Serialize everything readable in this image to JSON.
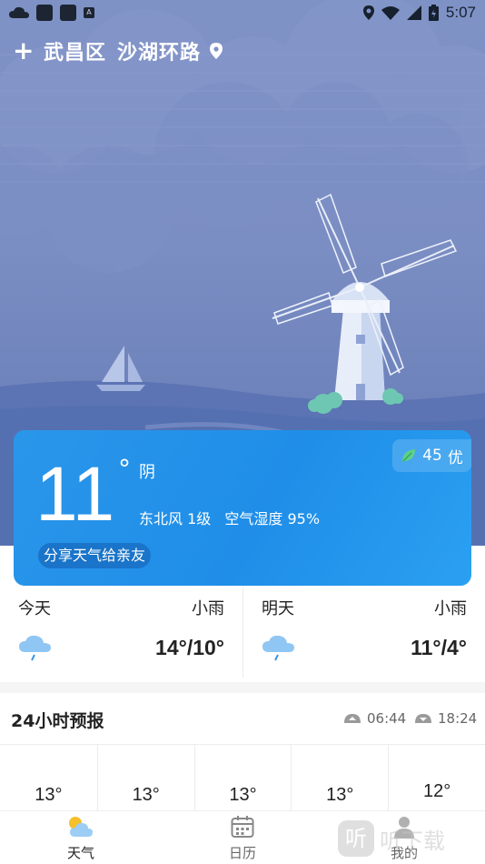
{
  "status_bar": {
    "time": "5:07",
    "a_icon_text": "A"
  },
  "location": {
    "add_label": "+",
    "district": "武昌区",
    "street": "沙湖环路"
  },
  "current": {
    "temperature": "11",
    "degree_symbol": "°",
    "condition": "阴",
    "wind": "东北风 1级",
    "humidity": "空气湿度 95%",
    "aqi_value": "45",
    "aqi_level": "优",
    "share_label": "分享天气给亲友"
  },
  "daily": [
    {
      "name": "今天",
      "condition": "小雨",
      "temp": "14°/10°",
      "icon": "light-rain-icon"
    },
    {
      "name": "明天",
      "condition": "小雨",
      "temp": "11°/4°",
      "icon": "light-rain-icon"
    }
  ],
  "forecast": {
    "title": "24小时预报",
    "sunrise": "06:44",
    "sunset": "18:24",
    "hours": [
      {
        "temp": "13°"
      },
      {
        "temp": "13°"
      },
      {
        "temp": "13°"
      },
      {
        "temp": "13°"
      },
      {
        "temp": "12°"
      }
    ]
  },
  "tabs": [
    {
      "label": "天气",
      "icon": "weather-icon",
      "active": true
    },
    {
      "label": "日历",
      "icon": "calendar-icon",
      "active": false
    },
    {
      "label": "我的",
      "icon": "user-icon",
      "active": false
    }
  ],
  "watermark": {
    "badge": "听",
    "text": "听下载"
  },
  "colors": {
    "card": "#2196f3",
    "hero": "#7b8ec3",
    "share": "#1a74c9"
  }
}
